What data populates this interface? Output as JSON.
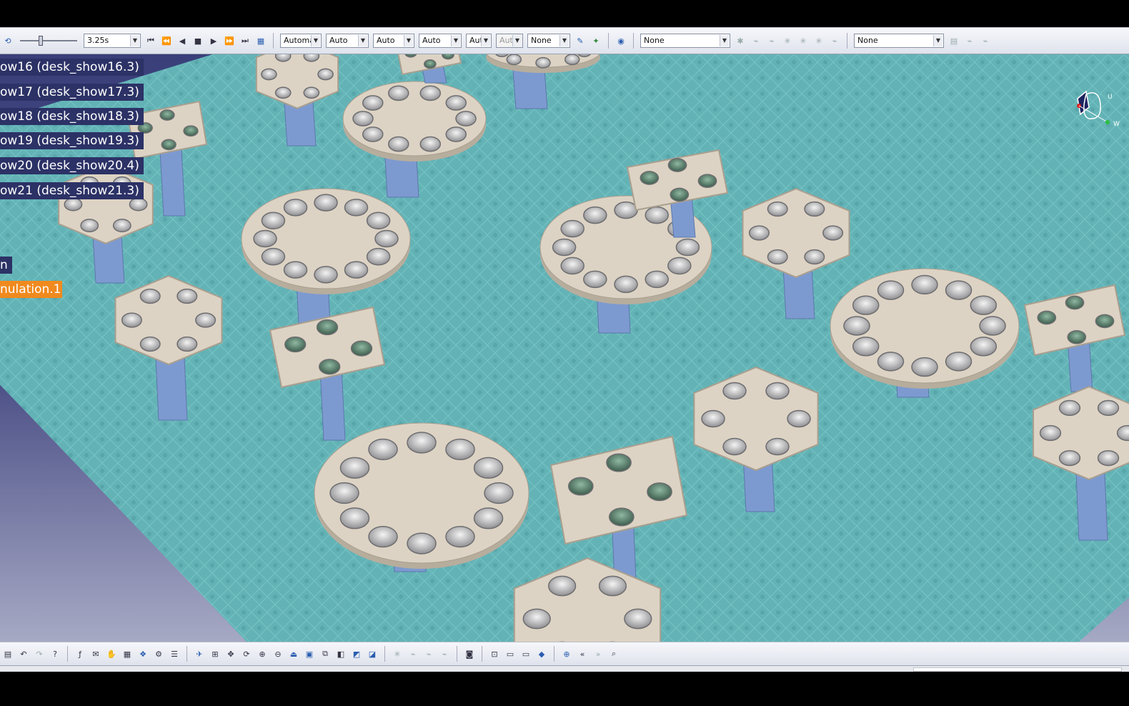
{
  "toolbar_top": {
    "time_value": "3.25s",
    "slider_fraction": 0.35,
    "combos": [
      {
        "value": "Automa",
        "disabled": false
      },
      {
        "value": "Auto",
        "disabled": false
      },
      {
        "value": "Auto",
        "disabled": false
      },
      {
        "value": "Auto",
        "disabled": false
      },
      {
        "value": "Aut",
        "disabled": false
      },
      {
        "value": "Aut",
        "disabled": true
      },
      {
        "value": "None",
        "disabled": false
      }
    ],
    "combo_none_1": "None",
    "combo_none_2": "None",
    "icons_playback": [
      "restart-icon",
      "first-frame-icon",
      "step-back-icon",
      "stop-icon",
      "play-icon",
      "step-forward-icon",
      "last-frame-icon",
      "sequence-icon"
    ]
  },
  "tree": {
    "items": [
      {
        "label": "ow16 (desk_show16.3)"
      },
      {
        "label": "ow17 (desk_show17.3)"
      },
      {
        "label": "ow18 (desk_show18.3)"
      },
      {
        "label": "ow19 (desk_show19.3)"
      },
      {
        "label": "ow20 (desk_show20.4)"
      },
      {
        "label": "ow21 (desk_show21.3)"
      }
    ],
    "node_n": "n",
    "selected": "nulation.1"
  },
  "compass": {
    "axis_u": "U",
    "axis_w": "W"
  },
  "colors": {
    "floor": "#63b3b6",
    "background_top": "#3a3f7a",
    "table_top": "#ddd3c4",
    "leg": "#7d9ad0",
    "selection": "#f08a1e",
    "tree_bg": "#2c3266"
  }
}
